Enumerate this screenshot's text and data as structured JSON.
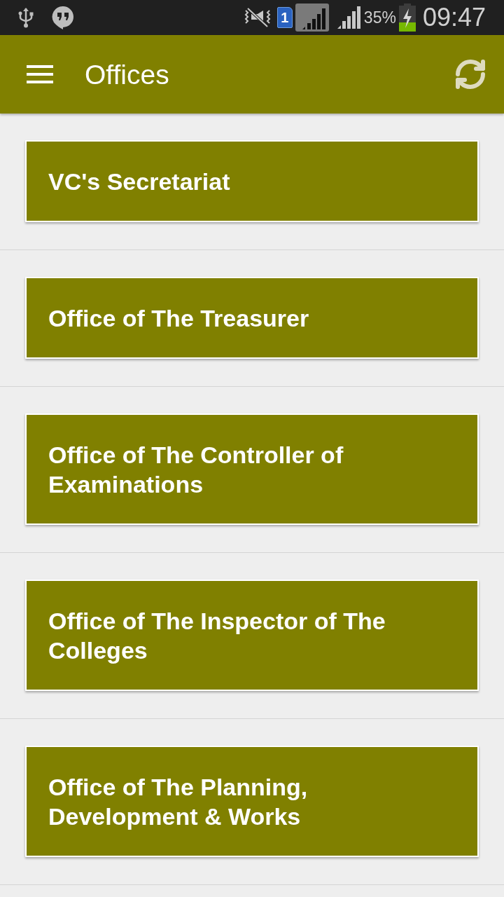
{
  "status_bar": {
    "sim_slot": "1",
    "battery": "35%",
    "time": "09:47"
  },
  "app_bar": {
    "title": "Offices"
  },
  "offices": [
    {
      "name": "VC's Secretariat"
    },
    {
      "name": "Office of The Treasurer"
    },
    {
      "name": "Office of The Controller of Examinations"
    },
    {
      "name": "Office of The Inspector of The Colleges"
    },
    {
      "name": "Office of The Planning, Development & Works"
    }
  ]
}
